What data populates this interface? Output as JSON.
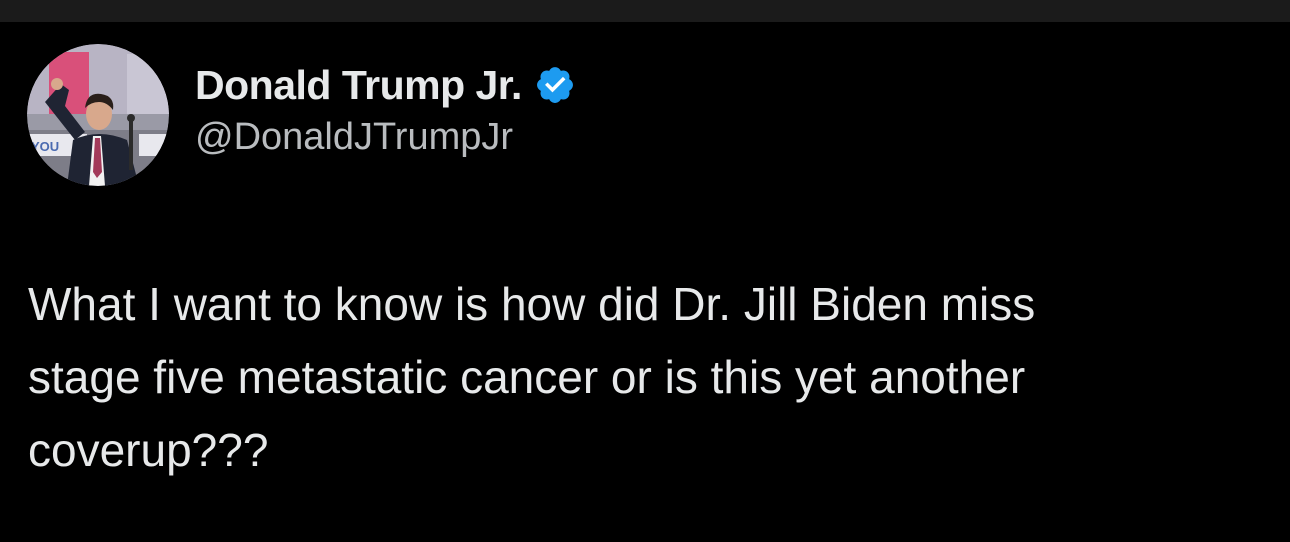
{
  "colors": {
    "background": "#000000",
    "top_bar": "#1b1b1b",
    "text_primary": "#e7e9ea",
    "text_secondary": "#b9bcbf",
    "verified_badge": "#1d9bf0"
  },
  "author": {
    "display_name": "Donald Trump Jr.",
    "handle": "@DonaldJTrumpJr",
    "verified": true,
    "verified_icon": "verified-check-badge",
    "avatar_icon": "profile-photo"
  },
  "tweet": {
    "lines": [
      "What I want to know is how did Dr. Jill Biden miss",
      "stage five metastatic cancer or is this yet another",
      "coverup???"
    ]
  }
}
